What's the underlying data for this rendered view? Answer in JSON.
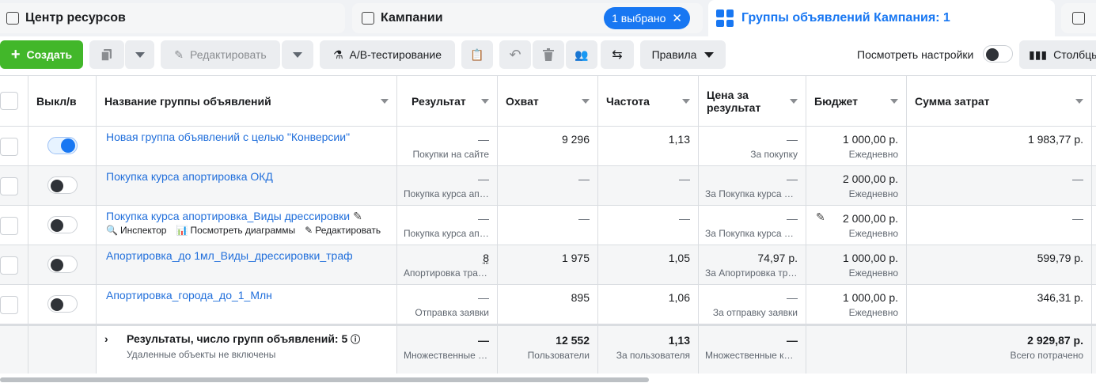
{
  "tabs": {
    "resource_center": "Центр ресурсов",
    "campaigns": "Кампании",
    "campaigns_selected": "1 выбрано",
    "ad_groups": "Группы объявлений Кампания: 1"
  },
  "toolbar": {
    "create": "Создать",
    "edit": "Редактировать",
    "ab_test": "A/B-тестирование",
    "rules": "Правила",
    "view_settings": "Посмотреть настройки",
    "columns": "Столбцы"
  },
  "columns": {
    "onoff": "Выкл/в",
    "name": "Название группы объявлений",
    "result": "Результат",
    "reach": "Охват",
    "frequency": "Частота",
    "cost_per_result": "Цена за результат",
    "budget": "Бюджет",
    "spent": "Сумма затрат"
  },
  "row_actions": {
    "inspector": "Инспектор",
    "charts": "Посмотреть диаграммы",
    "edit": "Редактировать"
  },
  "rows": [
    {
      "name": "Новая группа объявлений с целью \"Конверсии\"",
      "on": true,
      "result": "—",
      "result_sub": "Покупки на сайте",
      "reach": "9 296",
      "frequency": "1,13",
      "cpr": "—",
      "cpr_sub": "За покупку",
      "budget": "1 000,00 р.",
      "budget_sub": "Ежедневно",
      "spent": "1 983,77 р."
    },
    {
      "name": "Покупка курса апортировка ОКД",
      "on": false,
      "result": "—",
      "result_sub": "Покупка курса апортировка",
      "reach": "—",
      "frequency": "—",
      "cpr": "—",
      "cpr_sub": "За Покупка курса апортировка",
      "budget": "2 000,00 р.",
      "budget_sub": "Ежедневно",
      "spent": "—"
    },
    {
      "name": "Покупка курса апортировка_Виды дрессировки",
      "on": false,
      "result": "—",
      "result_sub": "Покупка курса апортировка",
      "reach": "—",
      "frequency": "—",
      "cpr": "—",
      "cpr_sub": "За Покупка курса апортировка",
      "budget": "2 000,00 р.",
      "budget_sub": "Ежедневно",
      "spent": "—"
    },
    {
      "name": "Апортировка_до 1мл_Виды_дрессировки_траф",
      "on": false,
      "result": "8",
      "result_sub": "Апортировка трафик",
      "reach": "1 975",
      "frequency": "1,05",
      "cpr": "74,97 р.",
      "cpr_sub": "За Апортировка трафик",
      "budget": "1 000,00 р.",
      "budget_sub": "Ежедневно",
      "spent": "599,79 р."
    },
    {
      "name": "Апортировка_города_до_1_Млн",
      "on": false,
      "result": "—",
      "result_sub": "Отправка заявки",
      "reach": "895",
      "frequency": "1,06",
      "cpr": "—",
      "cpr_sub": "За отправку заявки",
      "budget": "1 000,00 р.",
      "budget_sub": "Ежедневно",
      "spent": "346,31 р."
    }
  ],
  "totals": {
    "label": "Результаты, число групп объявлений: 5",
    "note": "Удаленные объекты не включены",
    "result": "—",
    "result_sub": "Множественные конверсии",
    "reach": "12 552",
    "reach_sub": "Пользователи",
    "frequency": "1,13",
    "frequency_sub": "За пользователя",
    "cpr": "—",
    "cpr_sub": "Множественные конверсии",
    "spent": "2 929,87 р.",
    "spent_sub": "Всего потрачено"
  }
}
